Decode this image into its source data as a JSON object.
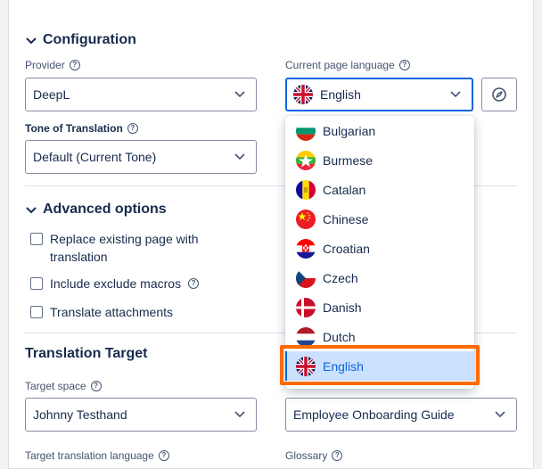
{
  "configuration": {
    "title": "Configuration",
    "provider_label": "Provider",
    "provider_value": "DeepL",
    "language_label": "Current page language",
    "language_value": "English",
    "tone_label": "Tone of Translation",
    "tone_value": "Default (Current Tone)"
  },
  "advanced": {
    "title": "Advanced options",
    "options": [
      "Replace existing page with translation",
      "Include exclude macros",
      "Translate attachments"
    ]
  },
  "language_dropdown": {
    "items": [
      "Bulgarian",
      "Burmese",
      "Catalan",
      "Chinese",
      "Croatian",
      "Czech",
      "Danish",
      "Dutch",
      "English"
    ],
    "selected": "English"
  },
  "target": {
    "title": "Translation Target",
    "space_label": "Target space",
    "space_value": "Johnny Testhand",
    "page_value": "Employee Onboarding Guide",
    "language_label": "Target translation language",
    "glossary_label": "Glossary"
  },
  "colors": {
    "accent": "#0c66e4",
    "highlight": "#ff6a00",
    "selected_bg": "#cce0ff"
  }
}
